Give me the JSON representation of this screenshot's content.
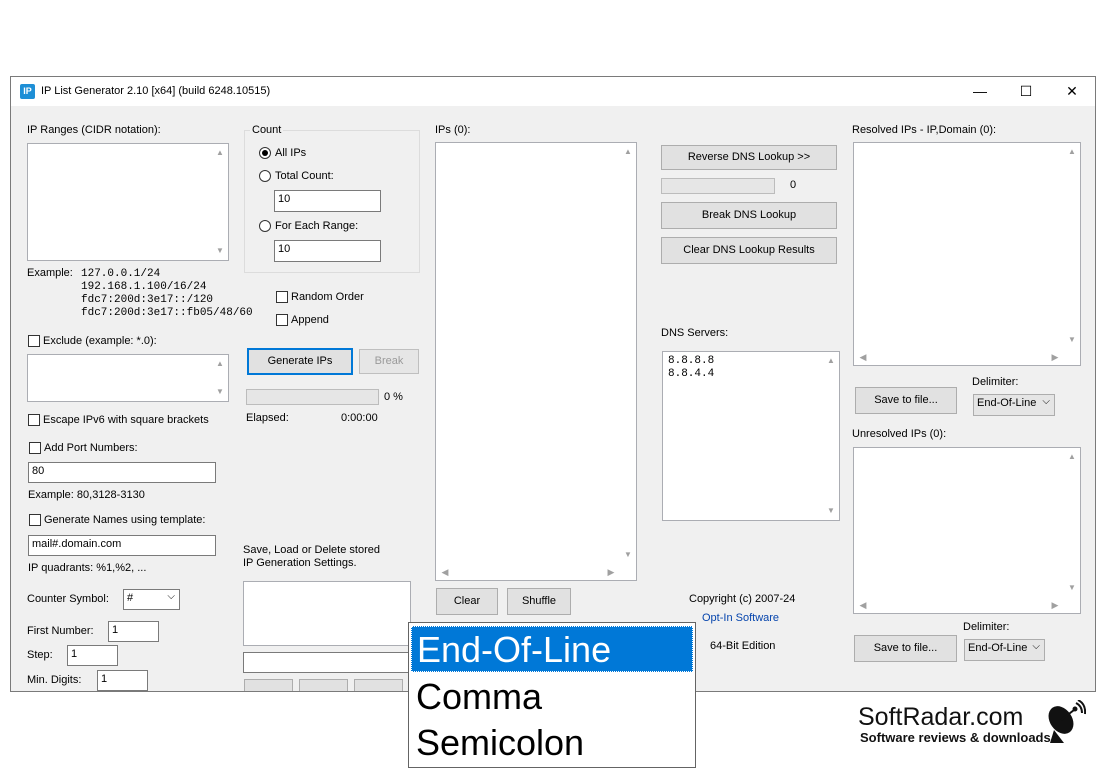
{
  "window": {
    "title": "IP List Generator 2.10 [x64] (build 6248.10515)",
    "icon_text": "IP",
    "minimize": "—",
    "maximize": "☐",
    "close": "✕"
  },
  "ranges": {
    "label": "IP Ranges (CIDR notation):",
    "value": "",
    "example_label": "Example:",
    "examples": [
      "127.0.0.1/24",
      "192.168.1.100/16/24",
      "fdc7:200d:3e17::/120",
      "fdc7:200d:3e17::fb05/48/60"
    ]
  },
  "exclude": {
    "label": "Exclude (example: *.0):",
    "value": ""
  },
  "escape_ipv6": "Escape IPv6 with square brackets",
  "port": {
    "label": "Add Port Numbers:",
    "value": "80",
    "example": "Example: 80,3128-3130"
  },
  "names": {
    "label": "Generate Names using template:",
    "value": "mail#.domain.com",
    "quadrants": "IP quadrants: %1,%2, ..."
  },
  "counter": {
    "symbol_label": "Counter Symbol:",
    "symbol_value": "#",
    "first_label": "First Number:",
    "first_value": "1",
    "step_label": "Step:",
    "step_value": "1",
    "digits_label": "Min. Digits:",
    "digits_value": "1"
  },
  "count": {
    "group_label": "Count",
    "all_ips": "All IPs",
    "total_count": "Total Count:",
    "total_value": "10",
    "for_each": "For Each Range:",
    "each_value": "10"
  },
  "options": {
    "random_order": "Random Order",
    "append": "Append"
  },
  "generate": {
    "generate_label": "Generate IPs",
    "break_label": "Break",
    "percent": "0 %",
    "elapsed_label": "Elapsed:",
    "elapsed_value": "0:00:00",
    "progress": 0
  },
  "settings": {
    "label_line1": "Save, Load or Delete stored",
    "label_line2": "IP Generation Settings."
  },
  "ips": {
    "label": "IPs (0):",
    "clear": "Clear",
    "shuffle": "Shuffle"
  },
  "dns": {
    "reverse": "Reverse DNS Lookup >>",
    "count": "0",
    "break": "Break DNS Lookup",
    "clear": "Clear DNS Lookup Results",
    "servers_label": "DNS Servers:",
    "servers": [
      "8.8.8.8",
      "8.8.4.4"
    ],
    "progress": 0
  },
  "copyright": {
    "line1": "Copyright (c) 2007-24",
    "link": "Opt-In Software",
    "edition": "64-Bit Edition"
  },
  "resolved": {
    "label": "Resolved IPs - IP,Domain (0):",
    "save": "Save to file...",
    "delimiter_label": "Delimiter:",
    "delimiter_value": "End-Of-Line"
  },
  "unresolved": {
    "label": "Unresolved IPs (0):",
    "save": "Save to file...",
    "delimiter_label": "Delimiter:",
    "delimiter_value": "End-Of-Line"
  },
  "dropdown": {
    "options": [
      "End-Of-Line",
      "Comma",
      "Semicolon"
    ],
    "selected": "End-Of-Line"
  },
  "watermark": {
    "title": "SoftRadar.com",
    "subtitle": "Software reviews & downloads"
  },
  "colors": {
    "accent": "#0078d7",
    "link": "#0645ad",
    "face": "#f0f0f0"
  }
}
